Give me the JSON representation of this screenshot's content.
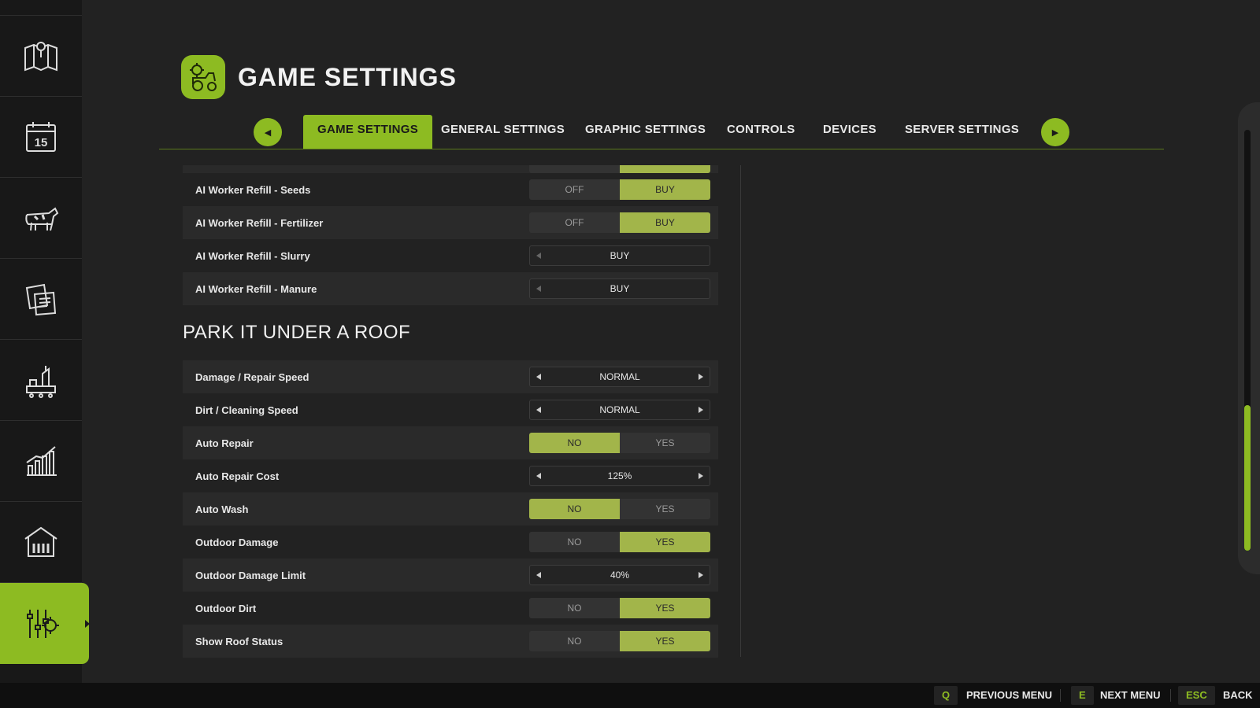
{
  "header": {
    "title": "GAME SETTINGS"
  },
  "tabs": [
    {
      "label": "GAME SETTINGS",
      "active": true
    },
    {
      "label": "GENERAL SETTINGS"
    },
    {
      "label": "GRAPHIC SETTINGS"
    },
    {
      "label": "CONTROLS"
    },
    {
      "label": "DEVICES"
    },
    {
      "label": "SERVER SETTINGS"
    }
  ],
  "sidebar": {
    "items": [
      {
        "icon": "map-icon"
      },
      {
        "icon": "calendar-icon",
        "text": "15"
      },
      {
        "icon": "cow-icon"
      },
      {
        "icon": "contracts-icon"
      },
      {
        "icon": "production-icon"
      },
      {
        "icon": "statistics-icon"
      },
      {
        "icon": "barn-icon"
      },
      {
        "icon": "settings-sliders-icon",
        "active": true
      }
    ]
  },
  "rows_top": [
    {
      "label": "AI Worker Refill - Seeds",
      "type": "toggle",
      "options": [
        "OFF",
        "BUY"
      ],
      "selected": 1
    },
    {
      "label": "AI Worker Refill - Fertilizer",
      "type": "toggle",
      "options": [
        "OFF",
        "BUY"
      ],
      "selected": 1
    },
    {
      "label": "AI Worker Refill - Slurry",
      "type": "stepper",
      "value": "BUY"
    },
    {
      "label": "AI Worker Refill - Manure",
      "type": "stepper",
      "value": "BUY"
    }
  ],
  "section": {
    "title": "PARK IT UNDER A ROOF"
  },
  "rows_section": [
    {
      "label": "Damage / Repair Speed",
      "type": "stepper",
      "value": "NORMAL"
    },
    {
      "label": "Dirt / Cleaning Speed",
      "type": "stepper",
      "value": "NORMAL"
    },
    {
      "label": "Auto Repair",
      "type": "toggle",
      "options": [
        "NO",
        "YES"
      ],
      "selected": 0
    },
    {
      "label": "Auto Repair Cost",
      "type": "stepper",
      "value": "125%"
    },
    {
      "label": "Auto Wash",
      "type": "toggle",
      "options": [
        "NO",
        "YES"
      ],
      "selected": 0
    },
    {
      "label": "Outdoor Damage",
      "type": "toggle",
      "options": [
        "NO",
        "YES"
      ],
      "selected": 1
    },
    {
      "label": "Outdoor Damage Limit",
      "type": "stepper",
      "value": "40%"
    },
    {
      "label": "Outdoor Dirt",
      "type": "toggle",
      "options": [
        "NO",
        "YES"
      ],
      "selected": 1
    },
    {
      "label": "Show Roof Status",
      "type": "toggle",
      "options": [
        "NO",
        "YES"
      ],
      "selected": 1
    }
  ],
  "footer": {
    "prev": {
      "key": "Q",
      "label": "PREVIOUS MENU"
    },
    "next": {
      "key": "E",
      "label": "NEXT MENU"
    },
    "back": {
      "key": "ESC",
      "label": "BACK"
    }
  },
  "colors": {
    "accent": "#8dbb22",
    "toggle_on": "#a2b54a",
    "background": "#222222"
  }
}
